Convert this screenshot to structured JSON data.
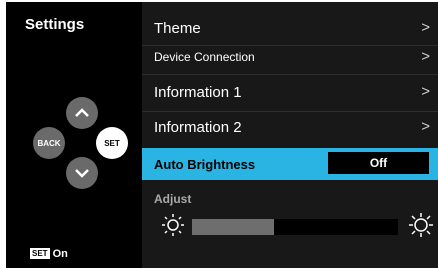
{
  "left_panel": {
    "title": "Settings",
    "dpad": {
      "up_icon": "chevron-up-icon",
      "down_icon": "chevron-down-icon",
      "left_label": "BACK",
      "center_label": "SET"
    },
    "status": {
      "set_label": "SET",
      "value": "On"
    }
  },
  "menu": {
    "items": [
      {
        "label": "Theme",
        "chevron": ">"
      },
      {
        "label": "Device Connection",
        "chevron": ">"
      },
      {
        "label": "Information 1",
        "chevron": ">"
      },
      {
        "label": "Information 2",
        "chevron": ">"
      }
    ],
    "auto_brightness": {
      "label": "Auto Brightness",
      "value": "Off"
    },
    "adjust": {
      "label": "Adjust",
      "min_icon": "sun-low-icon",
      "max_icon": "sun-high-icon",
      "level_fraction": 0.4
    }
  },
  "colors": {
    "highlight": "#2ab4e3",
    "panel_bg": "#181818",
    "screen_bg": "#000000",
    "slider_fill": "#6e6e6e"
  }
}
